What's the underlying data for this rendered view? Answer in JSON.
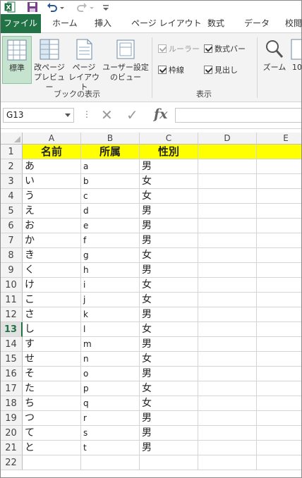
{
  "menu": {
    "tabs": [
      "ファイル",
      "ホーム",
      "挿入",
      "ページ レイアウト",
      "数式",
      "データ",
      "校閲"
    ]
  },
  "ribbon": {
    "views": {
      "normal": "標準",
      "pagebreak_line1": "改ページ",
      "pagebreak_line2": "プレビュー",
      "pagelayout_line1": "ページ",
      "pagelayout_line2": "レイアウト",
      "custom_line1": "ユーザー設定",
      "custom_line2": "のビュー",
      "group_label": "ブックの表示"
    },
    "show": {
      "ruler": "ルーラー",
      "formula_bar": "数式バー",
      "gridlines": "枠線",
      "headings": "見出し",
      "group_label": "表示"
    },
    "zoom": {
      "zoom_label": "ズーム",
      "zoom100_label": "10"
    }
  },
  "formula_bar": {
    "name_box": "G13",
    "more": "⋮",
    "cancel": "✕",
    "enter": "✓",
    "fx": "fx",
    "content": ""
  },
  "grid": {
    "columns": [
      "A",
      "B",
      "C",
      "D",
      "E"
    ],
    "selected_row": 13,
    "row_numbers": [
      "1",
      "2",
      "3",
      "4",
      "5",
      "6",
      "7",
      "8",
      "9",
      "10",
      "11",
      "12",
      "13",
      "14",
      "15",
      "16",
      "17",
      "18",
      "19",
      "20",
      "21",
      "22"
    ],
    "header": [
      "名前",
      "所属",
      "性別",
      "",
      ""
    ],
    "rows": [
      [
        "あ",
        "a",
        "男"
      ],
      [
        "い",
        "b",
        "女"
      ],
      [
        "う",
        "c",
        "女"
      ],
      [
        "え",
        "d",
        "男"
      ],
      [
        "お",
        "e",
        "男"
      ],
      [
        "か",
        "f",
        "男"
      ],
      [
        "き",
        "g",
        "女"
      ],
      [
        "く",
        "h",
        "男"
      ],
      [
        "け",
        "i",
        "女"
      ],
      [
        "こ",
        "j",
        "女"
      ],
      [
        "さ",
        "k",
        "男"
      ],
      [
        "し",
        "l",
        "女"
      ],
      [
        "す",
        "m",
        "男"
      ],
      [
        "せ",
        "n",
        "女"
      ],
      [
        "そ",
        "o",
        "男"
      ],
      [
        "た",
        "p",
        "女"
      ],
      [
        "ち",
        "q",
        "女"
      ],
      [
        "つ",
        "r",
        "男"
      ],
      [
        "て",
        "s",
        "男"
      ],
      [
        "と",
        "t",
        "男"
      ],
      [
        "",
        "",
        ""
      ]
    ],
    "header_fill": "#ffff00"
  },
  "colors": {
    "accent": "#217346"
  },
  "icons": {
    "excel": "excel-logo-icon",
    "save": "save-icon",
    "undo": "undo-icon",
    "redo": "redo-icon",
    "customize": "customize-qat-icon"
  }
}
